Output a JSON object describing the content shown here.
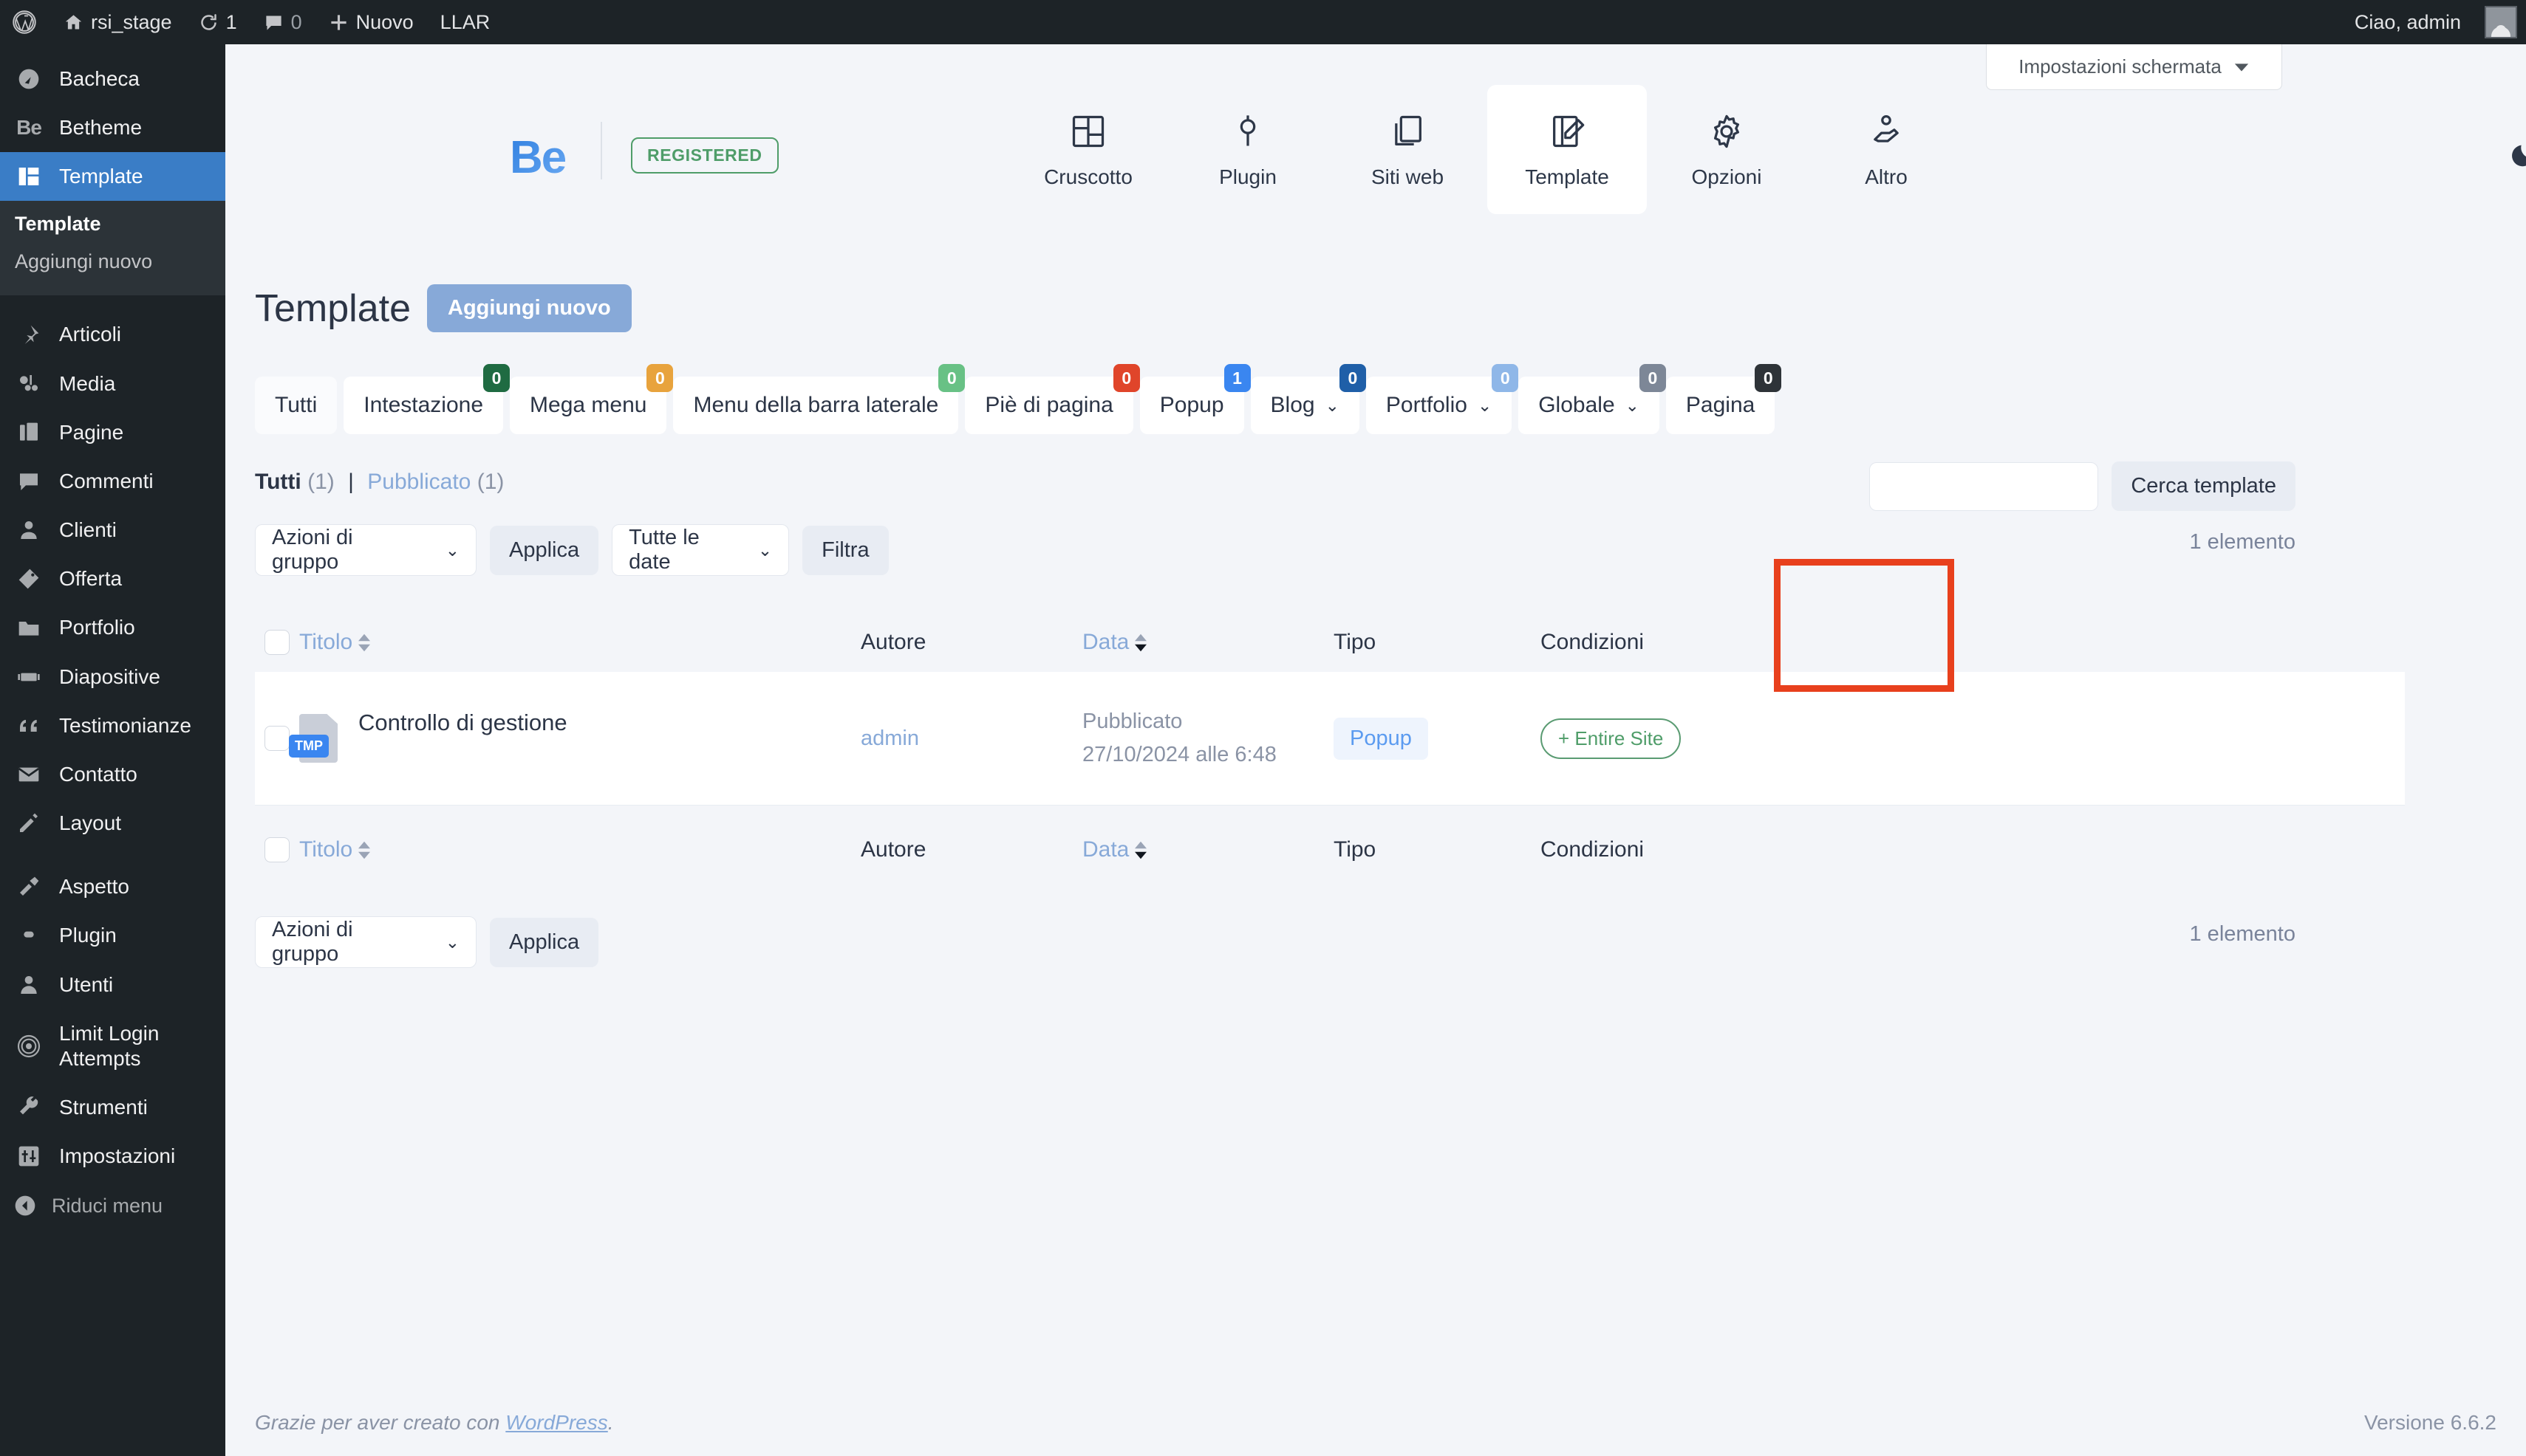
{
  "adminbar": {
    "site_name": "rsi_stage",
    "updates_count": "1",
    "comments_count": "0",
    "new_label": "Nuovo",
    "llar_label": "LLAR",
    "greeting": "Ciao, admin"
  },
  "screen_options": {
    "label": "Impostazioni schermata"
  },
  "sidebar": {
    "items": [
      {
        "label": "Bacheca",
        "icon": "dashboard-icon",
        "current": false
      },
      {
        "label": "Betheme",
        "icon": "betheme-be-icon",
        "current": false
      },
      {
        "label": "Template",
        "icon": "template-grid-icon",
        "current": true
      },
      {
        "label": "Articoli",
        "icon": "pin-icon",
        "current": false
      },
      {
        "label": "Media",
        "icon": "media-icon",
        "current": false
      },
      {
        "label": "Pagine",
        "icon": "pages-icon",
        "current": false
      },
      {
        "label": "Commenti",
        "icon": "comment-icon",
        "current": false
      },
      {
        "label": "Clienti",
        "icon": "clients-icon",
        "current": false
      },
      {
        "label": "Offerta",
        "icon": "offer-tag-icon",
        "current": false
      },
      {
        "label": "Portfolio",
        "icon": "folder-icon",
        "current": false
      },
      {
        "label": "Diapositive",
        "icon": "slides-icon",
        "current": false
      },
      {
        "label": "Testimonianze",
        "icon": "quote-icon",
        "current": false
      },
      {
        "label": "Contatto",
        "icon": "envelope-icon",
        "current": false
      },
      {
        "label": "Layout",
        "icon": "pencil-icon",
        "current": false
      },
      {
        "label": "Aspetto",
        "icon": "brush-icon",
        "current": false
      },
      {
        "label": "Plugin",
        "icon": "plug-icon",
        "current": false
      },
      {
        "label": "Utenti",
        "icon": "user-icon",
        "current": false
      },
      {
        "label": "Limit Login Attempts",
        "icon": "fingerprint-icon",
        "current": false
      },
      {
        "label": "Strumenti",
        "icon": "wrench-icon",
        "current": false
      },
      {
        "label": "Impostazioni",
        "icon": "sliders-icon",
        "current": false
      }
    ],
    "submenu": [
      {
        "label": "Template",
        "current": true
      },
      {
        "label": "Aggiungi nuovo",
        "current": false
      }
    ],
    "collapse_label": "Riduci menu"
  },
  "betheme_header": {
    "logo_text": "Be",
    "registered_label": "REGISTERED",
    "tabs": [
      {
        "label": "Cruscotto",
        "icon": "layout-grid-icon",
        "active": false
      },
      {
        "label": "Plugin",
        "icon": "plug-icon",
        "active": false
      },
      {
        "label": "Siti web",
        "icon": "copy-pages-icon",
        "active": false
      },
      {
        "label": "Template",
        "icon": "template-edit-icon",
        "active": true
      },
      {
        "label": "Opzioni",
        "icon": "gear-icon",
        "active": false
      },
      {
        "label": "Altro",
        "icon": "hand-heart-icon",
        "active": false
      }
    ],
    "dark_mode_icon": "moon-icon"
  },
  "page": {
    "title": "Template",
    "add_new_label": "Aggiungi nuovo"
  },
  "filter_tabs": [
    {
      "label": "Tutti",
      "badge": null,
      "badge_color": null,
      "dropdown": false,
      "plain": true
    },
    {
      "label": "Intestazione",
      "badge": "0",
      "badge_color": "#1f6b42",
      "dropdown": false,
      "plain": false
    },
    {
      "label": "Mega menu",
      "badge": "0",
      "badge_color": "#e8a33d",
      "dropdown": false,
      "plain": false
    },
    {
      "label": "Menu della barra laterale",
      "badge": "0",
      "badge_color": "#68c185",
      "dropdown": false,
      "plain": false
    },
    {
      "label": "Piè di pagina",
      "badge": "0",
      "badge_color": "#e0452a",
      "dropdown": false,
      "plain": false
    },
    {
      "label": "Popup",
      "badge": "1",
      "badge_color": "#3a86f0",
      "dropdown": false,
      "plain": false
    },
    {
      "label": "Blog",
      "badge": "0",
      "badge_color": "#1f5fa8",
      "dropdown": true,
      "plain": false
    },
    {
      "label": "Portfolio",
      "badge": "0",
      "badge_color": "#8fb7e8",
      "dropdown": true,
      "plain": false
    },
    {
      "label": "Globale",
      "badge": "0",
      "badge_color": "#7d8797",
      "dropdown": true,
      "plain": false
    },
    {
      "label": "Pagina",
      "badge": "0",
      "badge_color": "#2e3338",
      "dropdown": false,
      "plain": false
    }
  ],
  "subsubsub": {
    "all_label": "Tutti",
    "all_count": "(1)",
    "separator": "|",
    "published_label": "Pubblicato",
    "published_count": "(1)"
  },
  "tablenav_top": {
    "bulk_actions_label": "Azioni di gruppo",
    "apply_label": "Applica",
    "dates_label": "Tutte le date",
    "filter_label": "Filtra",
    "item_count": "1 elemento"
  },
  "search": {
    "value": "",
    "button_label": "Cerca template"
  },
  "table": {
    "columns": [
      {
        "label": "Titolo",
        "sortable": true,
        "link": true
      },
      {
        "label": "Autore",
        "sortable": false,
        "link": false
      },
      {
        "label": "Data",
        "sortable": true,
        "link": true
      },
      {
        "label": "Tipo",
        "sortable": false,
        "link": false
      },
      {
        "label": "Condizioni",
        "sortable": false,
        "link": false
      }
    ],
    "rows": [
      {
        "title": "Controllo di gestione",
        "icon": "template-file-icon",
        "icon_tag": "TMP",
        "author": "admin",
        "status": "Pubblicato",
        "date": "27/10/2024 alle 6:48",
        "type": "Popup",
        "condition": "+ Entire Site",
        "condition_highlighted": true
      }
    ]
  },
  "tablenav_bottom": {
    "bulk_actions_label": "Azioni di gruppo",
    "apply_label": "Applica",
    "item_count": "1 elemento"
  },
  "footer": {
    "thanks_text": "Grazie per aver creato con ",
    "wordpress_link": "WordPress",
    "period": ".",
    "version": "Versione 6.6.2"
  },
  "colors": {
    "accent_blue": "#3a86f0",
    "sidebar_current": "#3a7dc6",
    "green": "#4f9d69",
    "annotation_red": "#e8401d"
  }
}
